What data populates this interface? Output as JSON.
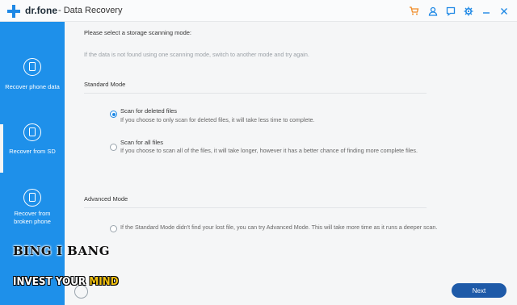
{
  "titlebar": {
    "brand": "dr.fone",
    "app_title": "- Data Recovery",
    "icons": [
      "cart-icon",
      "user-icon",
      "feedback-icon",
      "settings-icon",
      "minimize-icon",
      "close-icon"
    ],
    "accent": "#f08a24"
  },
  "sidebar": {
    "color": "#1e90ea",
    "items": [
      {
        "label": "Recover phone data",
        "icon": "phone-recover-icon"
      },
      {
        "label": "Recover from SD",
        "icon": "sd-card-icon"
      },
      {
        "label": "Recover from broken phone",
        "icon": "broken-phone-icon"
      }
    ]
  },
  "main": {
    "instruction": "Please select a storage scanning mode:",
    "hint": "If the data is not found using one scanning mode, switch to another mode and try again.",
    "standard": {
      "title": "Standard Mode",
      "options": [
        {
          "title": "Scan for deleted files",
          "desc": "If you choose to only scan for deleted files, it will take less time to complete.",
          "selected": true
        },
        {
          "title": "Scan for all files",
          "desc": "If you choose to scan all of the files, it will take longer, however it has a better chance of finding more complete files.",
          "selected": false
        }
      ]
    },
    "advanced": {
      "title": "Advanced Mode",
      "option_desc": "If the Standard Mode didn't find your lost file, you can try Advanced Mode. This will take more time as it runs a deeper scan.",
      "selected": false
    }
  },
  "footer": {
    "next_label": "Next"
  },
  "watermark": {
    "line1": "BING I BANG",
    "line2_a": "INVEST YOUR ",
    "line2_b": "MIND"
  }
}
